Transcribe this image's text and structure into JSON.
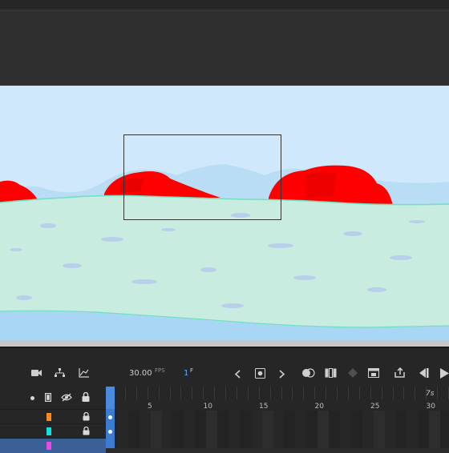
{
  "timeline": {
    "toolbar": {
      "fps_value": "30.00",
      "fps_unit": "FPS",
      "frame_value": "1",
      "frame_unit": "F"
    },
    "ruler": {
      "numbers": [
        "5",
        "10",
        "15",
        "20",
        "25",
        "30"
      ],
      "seconds_marker": "7s"
    },
    "layers": [
      {
        "color": "#ff8a1f",
        "selected": false
      },
      {
        "color": "#12e0e8",
        "selected": false
      },
      {
        "color": "#e94ae0",
        "selected": true
      }
    ]
  },
  "stage": {
    "sky_color": "#cfe8fb",
    "ground_color": "#c8ecdf",
    "rock_color": "#ff0000",
    "water_color": "#a9d6f5"
  }
}
